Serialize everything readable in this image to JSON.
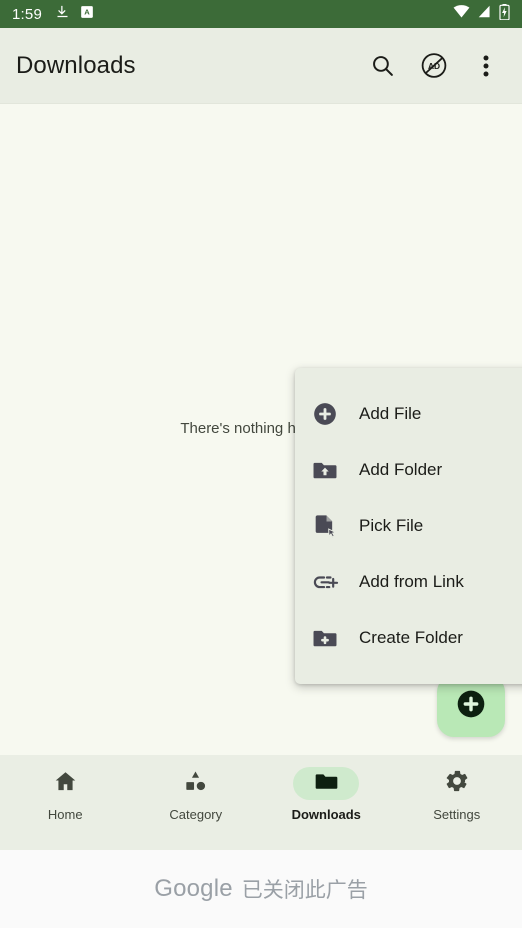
{
  "status_bar": {
    "time": "1:59",
    "left_icons": [
      "download-icon",
      "app-badge-a-icon"
    ],
    "right_icons": [
      "wifi-icon",
      "cellular-signal-icon",
      "battery-charging-icon"
    ],
    "background_color": "#3c6b38",
    "foreground_color": "#ffffff"
  },
  "app_bar": {
    "title": "Downloads",
    "background_color": "#e9ede3",
    "actions": [
      {
        "name": "search-icon",
        "label": "Search"
      },
      {
        "name": "block-ads-icon",
        "label": "AD"
      },
      {
        "name": "overflow-menu-icon",
        "label": "More options"
      }
    ]
  },
  "content": {
    "empty_message": "There's nothing here yet",
    "background_color": "#f7f9f0"
  },
  "popup_menu": {
    "background_color": "#e9ede3",
    "items": [
      {
        "label": "Add File",
        "icon": "plus-circle-icon"
      },
      {
        "label": "Add Folder",
        "icon": "folder-upload-icon"
      },
      {
        "label": "Pick File",
        "icon": "file-cursor-icon"
      },
      {
        "label": "Add from Link",
        "icon": "link-plus-icon"
      },
      {
        "label": "Create Folder",
        "icon": "folder-plus-icon"
      }
    ]
  },
  "fab": {
    "icon": "plus-icon",
    "label": "Add",
    "background_color": "#b9e8b6"
  },
  "bottom_nav": {
    "background_color": "#eaeee4",
    "active_pill_color": "#cfeacd",
    "items": [
      {
        "label": "Home",
        "icon": "home-icon",
        "active": false
      },
      {
        "label": "Category",
        "icon": "shapes-icon",
        "active": false
      },
      {
        "label": "Downloads",
        "icon": "folder-icon",
        "active": true
      },
      {
        "label": "Settings",
        "icon": "gear-icon",
        "active": false
      }
    ]
  },
  "ad_banner": {
    "brand": "Google",
    "message": "已关闭此广告",
    "background_color": "#fafafa"
  }
}
